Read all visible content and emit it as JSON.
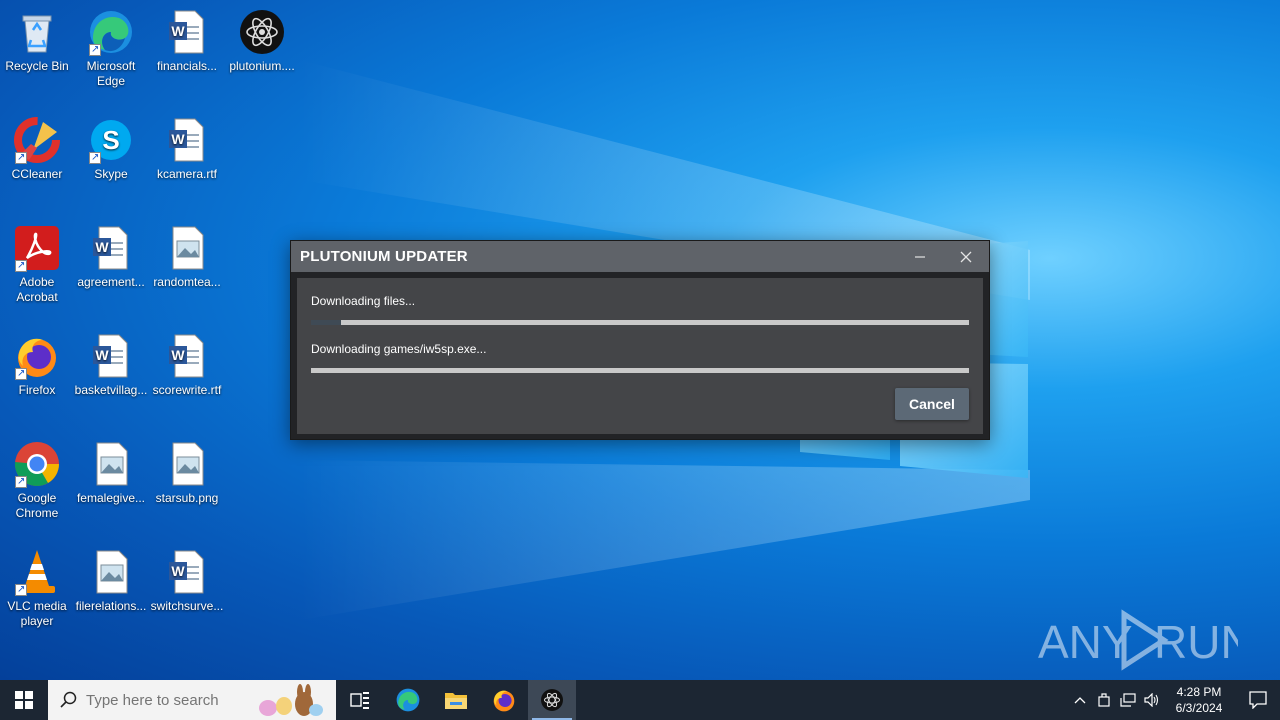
{
  "desktop": {
    "icons": [
      {
        "label": "Recycle Bin",
        "icon": "recycle-bin-icon",
        "shortcut": false
      },
      {
        "label": "Microsoft Edge",
        "icon": "edge-icon",
        "shortcut": true
      },
      {
        "label": "financials...",
        "icon": "word-doc-icon",
        "shortcut": false
      },
      {
        "label": "plutonium....",
        "icon": "plutonium-icon",
        "shortcut": false
      },
      {
        "label": "CCleaner",
        "icon": "ccleaner-icon",
        "shortcut": true
      },
      {
        "label": "Skype",
        "icon": "skype-icon",
        "shortcut": true
      },
      {
        "label": "kcamera.rtf",
        "icon": "word-doc-icon",
        "shortcut": false
      },
      {
        "label": "Adobe Acrobat",
        "icon": "acrobat-icon",
        "shortcut": true
      },
      {
        "label": "agreement...",
        "icon": "word-doc-icon",
        "shortcut": false
      },
      {
        "label": "randomtea...",
        "icon": "image-file-icon",
        "shortcut": false
      },
      {
        "label": "Firefox",
        "icon": "firefox-icon",
        "shortcut": true
      },
      {
        "label": "basketvillag...",
        "icon": "word-doc-icon",
        "shortcut": false
      },
      {
        "label": "scorewrite.rtf",
        "icon": "word-doc-icon",
        "shortcut": false
      },
      {
        "label": "Google Chrome",
        "icon": "chrome-icon",
        "shortcut": true
      },
      {
        "label": "femalegive...",
        "icon": "image-file-icon",
        "shortcut": false
      },
      {
        "label": "starsub.png",
        "icon": "image-file-icon",
        "shortcut": false
      },
      {
        "label": "VLC media player",
        "icon": "vlc-icon",
        "shortcut": true
      },
      {
        "label": "filerelations...",
        "icon": "image-file-icon",
        "shortcut": false
      },
      {
        "label": "switchsurve...",
        "icon": "word-doc-icon",
        "shortcut": false
      }
    ]
  },
  "dialog": {
    "title": "PLUTONIUM UPDATER",
    "minimize_icon": "minimize-icon",
    "close_icon": "close-icon",
    "status1": "Downloading files...",
    "progress1": 0.045,
    "status2": "Downloading games/iw5sp.exe...",
    "progress2": 0,
    "cancel_label": "Cancel"
  },
  "watermark": {
    "text": "ANY RUN"
  },
  "taskbar": {
    "search_placeholder": "Type here to search",
    "apps": [
      "task-view-icon",
      "edge-icon",
      "file-explorer-icon",
      "firefox-icon",
      "plutonium-icon"
    ],
    "active_app": "plutonium-icon",
    "time": "4:28 PM",
    "date": "6/3/2024"
  },
  "colors": {
    "dialog_titlebar": "#5f6369",
    "dialog_body": "#444548",
    "cancel_button": "#5c6976",
    "taskbar": "#1c2633"
  }
}
